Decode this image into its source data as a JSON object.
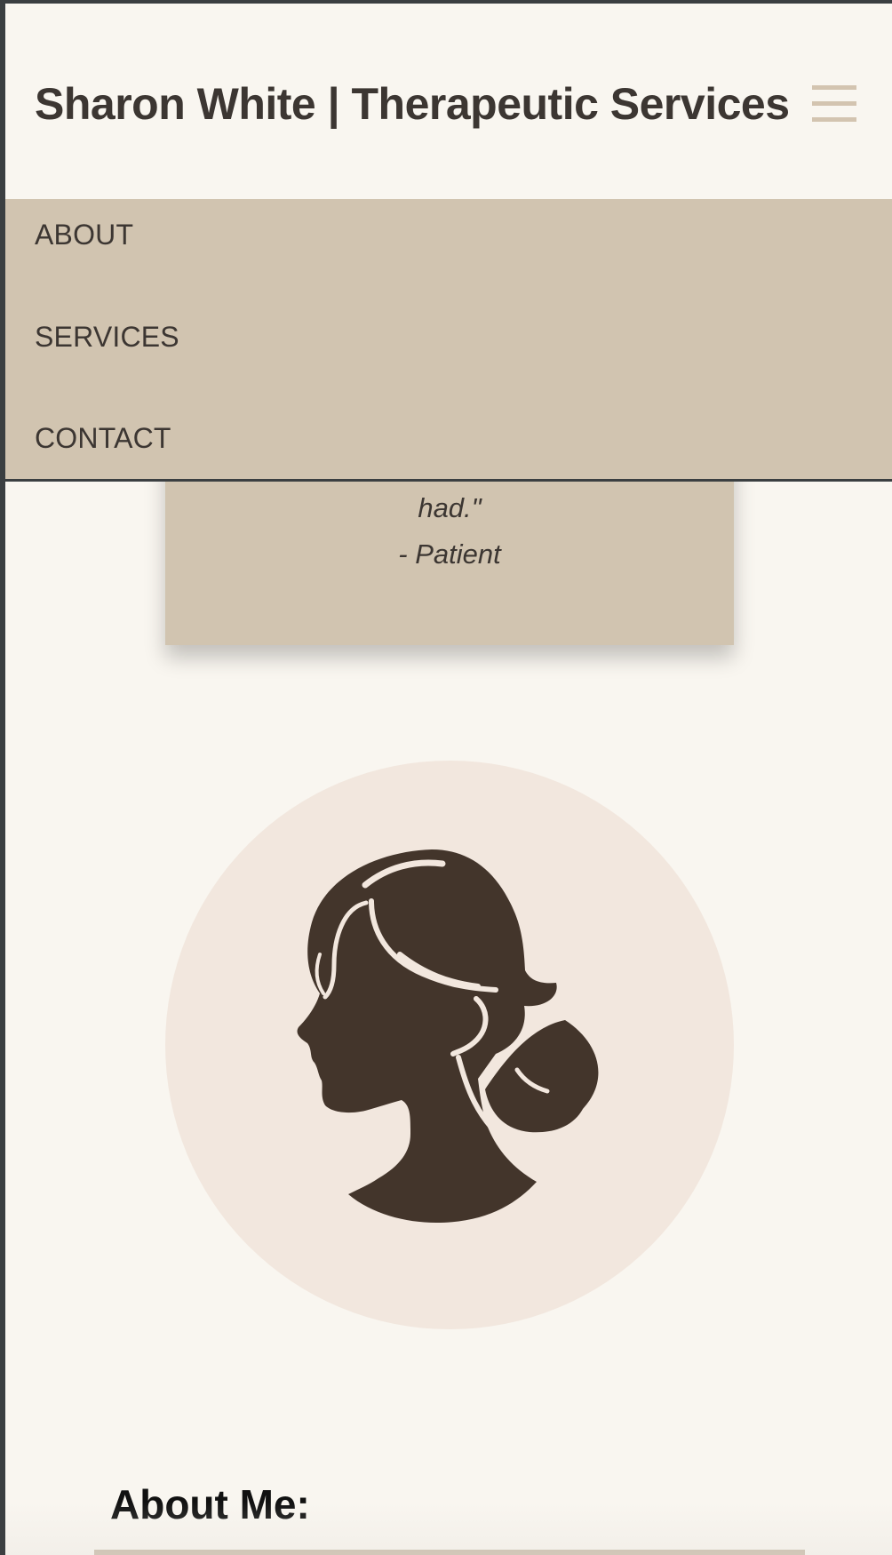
{
  "header": {
    "site_title": "Sharon White | Therapeutic Services",
    "menu_icon": "hamburger-menu-icon"
  },
  "nav": {
    "items": [
      {
        "label": "ABOUT"
      },
      {
        "label": "SERVICES"
      },
      {
        "label": "CONTACT"
      }
    ]
  },
  "testimonial": {
    "quote_tail": "had.\"",
    "author": "- Patient"
  },
  "portrait": {
    "icon": "woman-profile-silhouette-icon"
  },
  "about": {
    "heading": "About Me:"
  },
  "colors": {
    "background": "#f9f6f0",
    "nav_background": "#d1c4b0",
    "card_background": "#d1c4b0",
    "portrait_circle": "#f2e7de",
    "silhouette": "#43352b",
    "text": "#3c3632",
    "hamburger": "#d3c4b0"
  }
}
